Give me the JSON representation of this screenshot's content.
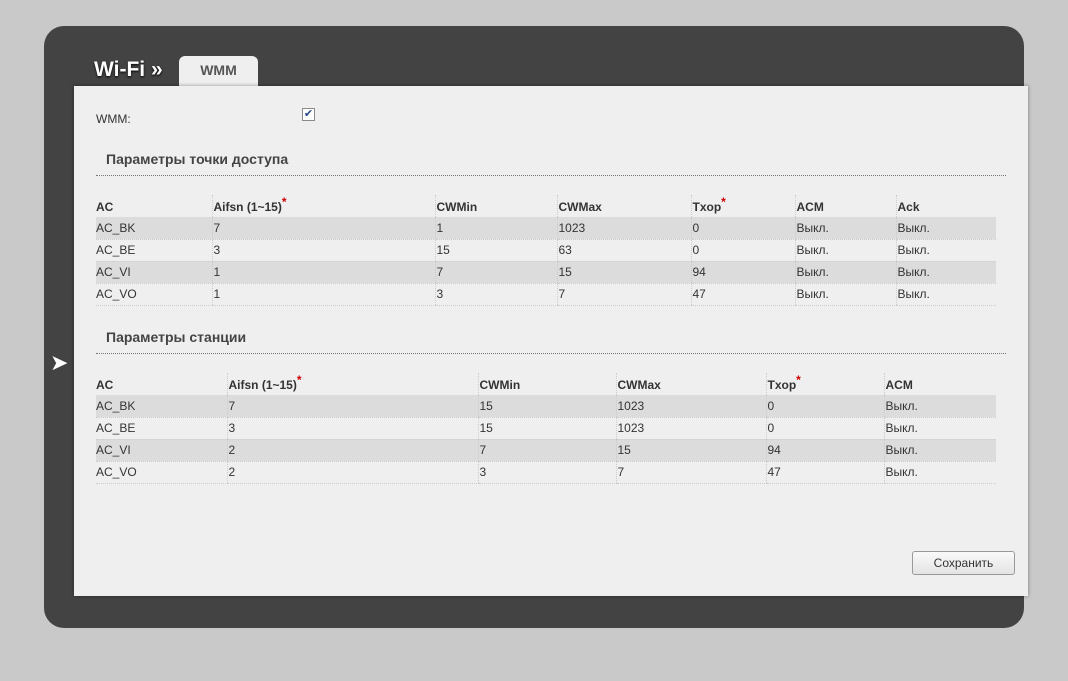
{
  "header": {
    "title": "Wi-Fi »",
    "tab": "WMM"
  },
  "wmm": {
    "label": "WMM:",
    "checked": true
  },
  "ap": {
    "title": "Параметры точки доступа",
    "columns": [
      "AC",
      "Aifsn (1~15)",
      "CWMin",
      "CWMax",
      "Txop",
      "ACM",
      "Ack"
    ],
    "required": [
      false,
      true,
      false,
      false,
      true,
      false,
      false
    ],
    "rows": [
      [
        "AC_BK",
        "7",
        "1",
        "1023",
        "0",
        "Выкл.",
        "Выкл."
      ],
      [
        "AC_BE",
        "3",
        "15",
        "63",
        "0",
        "Выкл.",
        "Выкл."
      ],
      [
        "AC_VI",
        "1",
        "7",
        "15",
        "94",
        "Выкл.",
        "Выкл."
      ],
      [
        "AC_VO",
        "1",
        "3",
        "7",
        "47",
        "Выкл.",
        "Выкл."
      ]
    ]
  },
  "sta": {
    "title": "Параметры станции",
    "columns": [
      "AC",
      "Aifsn (1~15)",
      "CWMin",
      "CWMax",
      "Txop",
      "ACM"
    ],
    "required": [
      false,
      true,
      false,
      false,
      true,
      false
    ],
    "rows": [
      [
        "AC_BK",
        "7",
        "15",
        "1023",
        "0",
        "Выкл."
      ],
      [
        "AC_BE",
        "3",
        "15",
        "1023",
        "0",
        "Выкл."
      ],
      [
        "AC_VI",
        "2",
        "7",
        "15",
        "94",
        "Выкл."
      ],
      [
        "AC_VO",
        "2",
        "3",
        "7",
        "47",
        "Выкл."
      ]
    ]
  },
  "save_label": "Сохранить",
  "icons": {
    "back": "back-arrow-icon",
    "check": "checkmark-icon"
  }
}
